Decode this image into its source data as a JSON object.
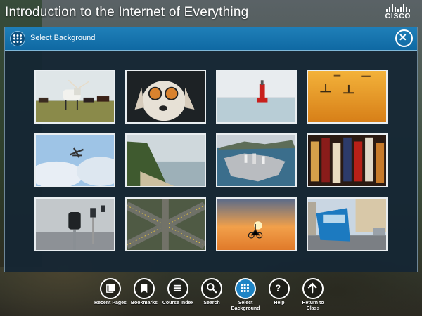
{
  "app": {
    "title": "Introduction to the Internet of Everything",
    "logo_text": "CISCO"
  },
  "modal": {
    "title": "Select Background"
  },
  "backgrounds": [
    {
      "subject": "longhorn cattle"
    },
    {
      "subject": "dog with goggles"
    },
    {
      "subject": "buoy at sea"
    },
    {
      "subject": "paddleboarders at sunset"
    },
    {
      "subject": "seaplane in sky"
    },
    {
      "subject": "coastal cliffs"
    },
    {
      "subject": "city harbor aerial"
    },
    {
      "subject": "guitars on wall"
    },
    {
      "subject": "parking meters"
    },
    {
      "subject": "aerial highway intersection"
    },
    {
      "subject": "cyclist at sunset"
    },
    {
      "subject": "blue tram in city"
    }
  ],
  "toolbar": {
    "items": [
      {
        "label": "Recent Pages",
        "icon": "pages-icon"
      },
      {
        "label": "Bookmarks",
        "icon": "bookmark-icon"
      },
      {
        "label": "Course Index",
        "icon": "list-icon"
      },
      {
        "label": "Search",
        "icon": "search-icon"
      },
      {
        "label": "Select Background",
        "icon": "grid-icon"
      },
      {
        "label": "Help",
        "icon": "help-icon"
      },
      {
        "label": "Return to Class",
        "icon": "arrow-up-icon"
      }
    ]
  },
  "colors": {
    "header_blue": "#1f7fb8",
    "modal_bg": "#142634",
    "active_tool": "#1f84c5"
  }
}
